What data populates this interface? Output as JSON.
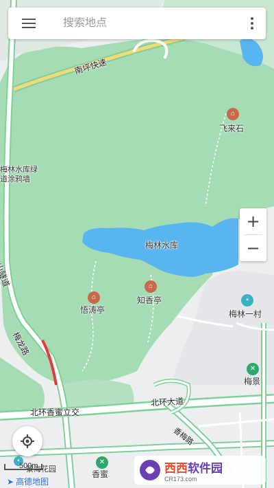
{
  "search": {
    "placeholder": "搜索地点",
    "menu_icon": "menu-icon",
    "more_icon": "more-vertical-icon"
  },
  "controls": {
    "zoom_in": "+",
    "zoom_out": "−",
    "locate_icon": "locate-icon"
  },
  "scale": {
    "label": "500m"
  },
  "brand": {
    "name": "高德地图"
  },
  "watermark": {
    "name": "西西",
    "sub_name": "软件园",
    "url": "CR173.com"
  },
  "pois": [
    {
      "label": "飞来石",
      "icon": "scenic-spot-icon"
    },
    {
      "label": "梅林水库绿道涂鸦墙"
    },
    {
      "label": "梅林水库"
    },
    {
      "label": "悟涛亭",
      "icon": "scenic-spot-icon"
    },
    {
      "label": "知香亭",
      "icon": "scenic-spot-icon"
    },
    {
      "label": "梅林一村",
      "icon": "residential-icon"
    },
    {
      "label": "梅景",
      "icon": "metro-station-icon"
    },
    {
      "label": "香蜜",
      "icon": "metro-station-icon"
    },
    {
      "label": "景海花园",
      "icon": "residential-icon"
    }
  ],
  "roads": {
    "nanping": "南坪快速",
    "meilong": "梅龙路",
    "huanxiang": "北环香蜜立交",
    "beihuan": "北环大道",
    "xiangmei": "香梅路",
    "tunnel": "山隧道"
  },
  "colors": {
    "park": "#a6dcb4",
    "water": "#58b5f0",
    "road": "#ffffff",
    "road_edge": "#7fcf98",
    "expressway": "#f4d978"
  }
}
